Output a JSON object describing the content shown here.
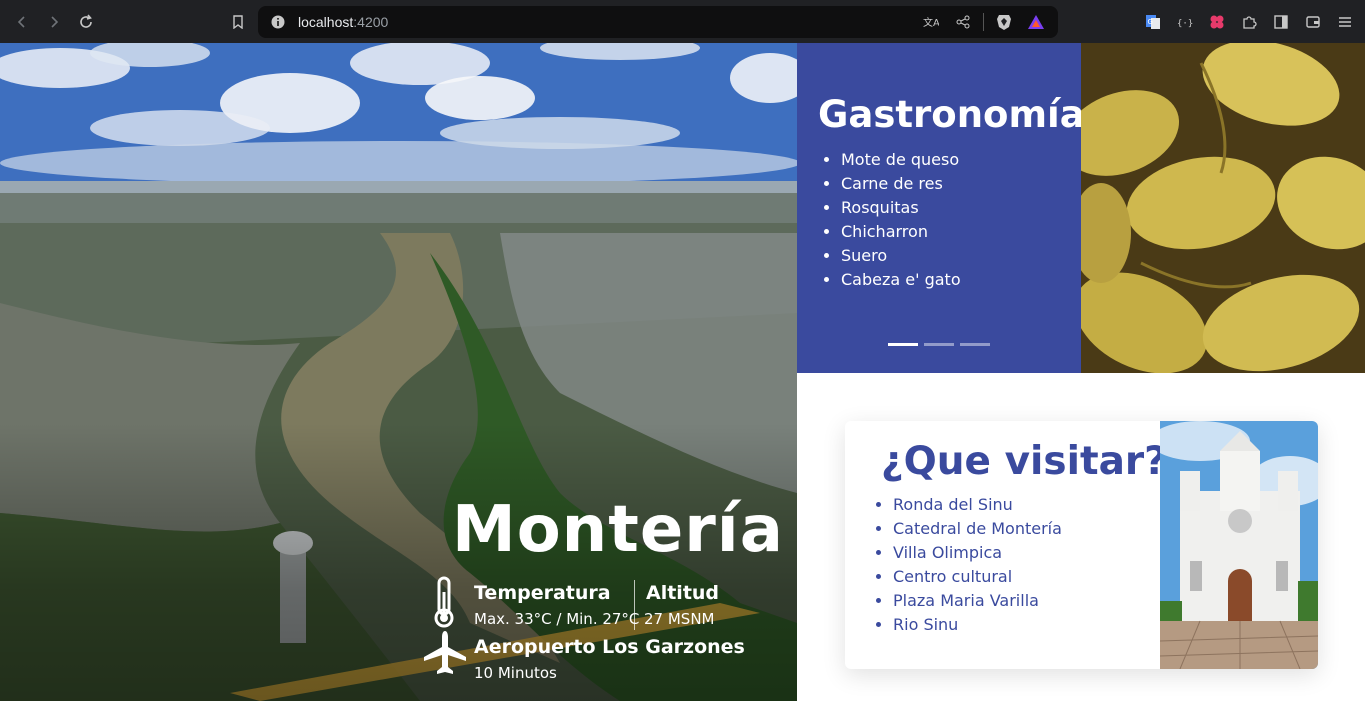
{
  "browser": {
    "url_host": "localhost",
    "url_port": ":4200"
  },
  "hero": {
    "city": "Montería",
    "temperature_label": "Temperatura",
    "temperature_value": "Max. 33°C / Min. 27°C",
    "altitude_label": "Altitud",
    "altitude_value": "27 MSNM",
    "airport_label": "Aeropuerto Los Garzones",
    "airport_value": "10 Minutos"
  },
  "gastronomia": {
    "title": "Gastronomía",
    "items": [
      "Mote de queso",
      "Carne de res",
      "Rosquitas",
      "Chicharron",
      "Suero",
      "Cabeza e' gato"
    ],
    "slides": 3,
    "active_slide": 1
  },
  "visitar": {
    "title": "¿Que visitar?",
    "items": [
      "Ronda del Sinu",
      "Catedral de Montería",
      "Villa Olimpica",
      "Centro cultural",
      "Plaza Maria Varilla",
      "Rio Sinu"
    ]
  },
  "colors": {
    "accent": "#3a4a9e",
    "chrome": "#202124"
  },
  "icons": [
    "back-icon",
    "forward-icon",
    "reload-icon",
    "bookmark-icon",
    "info-icon",
    "translate-icon",
    "share-icon",
    "brave-icon",
    "rewards-icon",
    "extensions-icon",
    "thermometer-icon",
    "plane-icon"
  ]
}
